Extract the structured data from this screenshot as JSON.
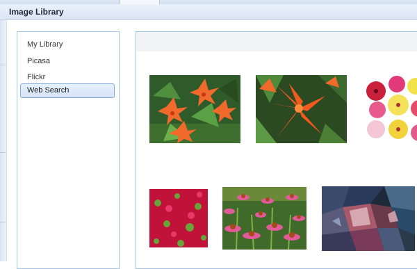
{
  "dialog": {
    "title": "Image Library"
  },
  "sidebar": {
    "items": [
      {
        "label": "My Library",
        "selected": false
      },
      {
        "label": "Picasa",
        "selected": false
      },
      {
        "label": "Flickr",
        "selected": false
      },
      {
        "label": "Web Search",
        "selected": true
      }
    ]
  },
  "gallery": {
    "thumbnails": [
      {
        "subject": "orange lilies among green leaves"
      },
      {
        "subject": "single orange lily close-up"
      },
      {
        "subject": "mixed hibiscus flowers, red pink yellow white"
      },
      {
        "subject": "red pink flower bed"
      },
      {
        "subject": "pink coneflowers (echinacea)"
      },
      {
        "subject": "crumpled colorful paper / fabric"
      }
    ]
  },
  "colors": {
    "accent_border": "#9fc6e6",
    "selected_bg": "#d4e4f7",
    "selected_border": "#84acd9"
  }
}
